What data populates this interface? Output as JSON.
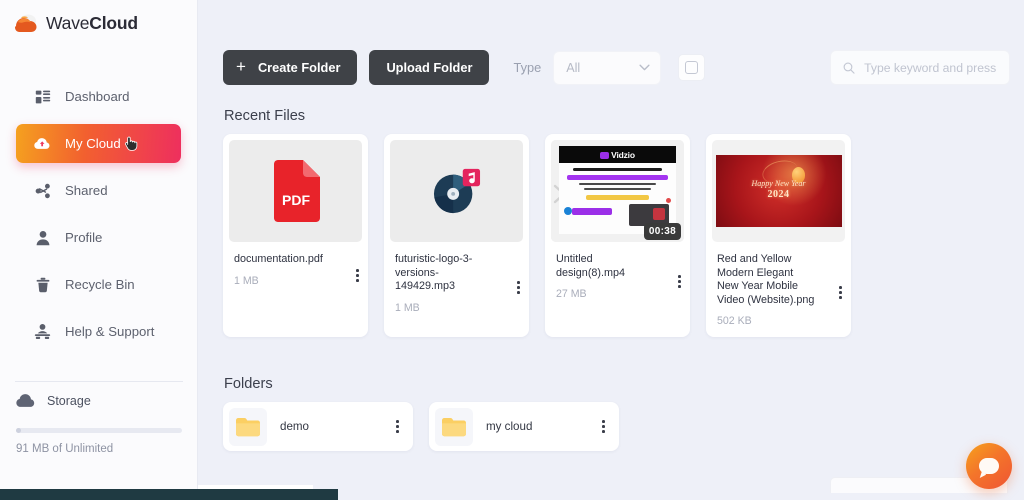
{
  "brand": {
    "name_light": "Wave",
    "name_bold": "Cloud",
    "logo_icon": "wave-cloud-logo-icon"
  },
  "sidebar": {
    "items": [
      {
        "label": "Dashboard",
        "icon": "dashboard-icon",
        "active": false
      },
      {
        "label": "My Cloud",
        "icon": "cloud-icon",
        "active": true
      },
      {
        "label": "Shared",
        "icon": "share-icon",
        "active": false
      },
      {
        "label": "Profile",
        "icon": "user-icon",
        "active": false
      },
      {
        "label": "Recycle Bin",
        "icon": "trash-icon",
        "active": false
      },
      {
        "label": "Help & Support",
        "icon": "support-icon",
        "active": false
      }
    ],
    "storage": {
      "label": "Storage",
      "icon": "cloud-storage-icon",
      "usage_text": "91 MB of Unlimited",
      "used_percent": 3
    }
  },
  "toolbar": {
    "create_folder_label": "Create Folder",
    "create_folder_icon": "plus-icon",
    "upload_folder_label": "Upload Folder",
    "type_label": "Type",
    "type_value": "All",
    "type_chevron_icon": "chevron-down-icon",
    "select_all_checkbox": "unchecked"
  },
  "search": {
    "placeholder": "Type keyword and press",
    "value": "",
    "icon": "search-icon"
  },
  "sections": {
    "recent_files_title": "Recent Files",
    "folders_title": "Folders"
  },
  "files": [
    {
      "name": "documentation.pdf",
      "size": "1 MB",
      "thumb_type": "pdf",
      "thumb_icon": "pdf-file-icon",
      "thumb_label": "PDF",
      "menu_icon": "more-vertical-icon"
    },
    {
      "name": "futuristic-logo-3-versions-149429.mp3",
      "size": "1 MB",
      "thumb_type": "audio",
      "thumb_icon": "audio-disc-icon",
      "menu_icon": "more-vertical-icon"
    },
    {
      "name": "Untitled design(8).mp4",
      "size": "27 MB",
      "thumb_type": "video",
      "thumb_icon": "video-thumbnail",
      "duration": "00:38",
      "preview_logo_text": "Vidzio",
      "menu_icon": "more-vertical-icon"
    },
    {
      "name": "Red and Yellow Modern Elegant New Year Mobile Video (Website).png",
      "size": "502 KB",
      "thumb_type": "image",
      "thumb_icon": "image-thumbnail",
      "preview_title": "Happy New Year",
      "preview_year": "2024",
      "menu_icon": "more-vertical-icon"
    }
  ],
  "folders": [
    {
      "name": "demo",
      "icon": "folder-icon",
      "menu_icon": "more-vertical-icon"
    },
    {
      "name": "my cloud",
      "icon": "folder-icon",
      "menu_icon": "more-vertical-icon"
    }
  ],
  "chat_widget": {
    "icon": "chat-bubble-icon"
  },
  "colors": {
    "accent_start": "#f5a11f",
    "accent_end": "#ee2f5e",
    "button_dark": "#3f4247",
    "page_bg": "#eef0f8",
    "sidebar_bg": "#fbfbfd",
    "card_bg": "#ffffff",
    "pdf_red": "#e8232a",
    "folder_yellow": "#fbcf63"
  }
}
